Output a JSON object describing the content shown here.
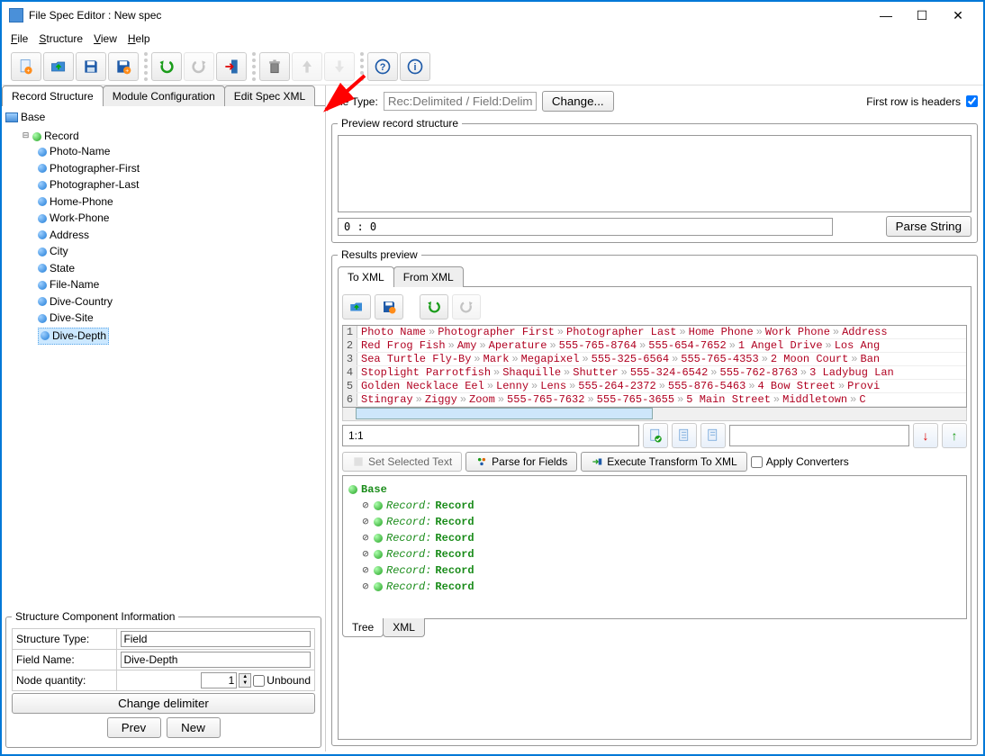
{
  "window": {
    "title": "File Spec Editor : New spec"
  },
  "menu": {
    "file": "File",
    "structure": "Structure",
    "view": "View",
    "help": "Help"
  },
  "main_tabs": {
    "record_structure": "Record Structure",
    "module_configuration": "Module Configuration",
    "edit_spec_xml": "Edit Spec XML"
  },
  "tree": {
    "root": "Base",
    "record": "Record",
    "fields": [
      "Photo-Name",
      "Photographer-First",
      "Photographer-Last",
      "Home-Phone",
      "Work-Phone",
      "Address",
      "City",
      "State",
      "File-Name",
      "Dive-Country",
      "Dive-Site",
      "Dive-Depth"
    ],
    "selected": "Dive-Depth"
  },
  "struct_info": {
    "legend": "Structure Component Information",
    "structure_type_label": "Structure Type:",
    "structure_type_value": "Field",
    "field_name_label": "Field Name:",
    "field_name_value": "Dive-Depth",
    "node_qty_label": "Node quantity:",
    "node_qty_value": "1",
    "unbound_label": "Unbound",
    "change_delimiter": "Change delimiter",
    "prev": "Prev",
    "new": "New"
  },
  "file_type": {
    "label": "File Type:",
    "placeholder": "Rec:Delimited / Field:Delimited",
    "change": "Change...",
    "first_row_headers": "First row is headers"
  },
  "preview": {
    "legend": "Preview record structure",
    "position": "0 : 0",
    "parse_string": "Parse String"
  },
  "results": {
    "legend": "Results preview",
    "to_xml": "To XML",
    "from_xml": "From XML",
    "pos": "1:1",
    "set_selected": "Set Selected Text",
    "parse_fields": "Parse for Fields",
    "execute_transform": "Execute Transform To XML",
    "apply_converters": "Apply Converters",
    "rows": [
      [
        "Photo Name",
        "Photographer First",
        "Photographer Last",
        "Home Phone",
        "Work Phone",
        "Address"
      ],
      [
        "Red Frog Fish",
        "Amy",
        "Aperature",
        "555-765-8764",
        "555-654-7652",
        "1 Angel Drive",
        "Los Ang"
      ],
      [
        "Sea Turtle Fly-By",
        "Mark",
        "Megapixel",
        "555-325-6564",
        "555-765-4353",
        "2 Moon Court",
        "Ban"
      ],
      [
        "Stoplight Parrotfish",
        "Shaquille",
        "Shutter",
        "555-324-6542",
        "555-762-8763",
        "3 Ladybug Lan"
      ],
      [
        "Golden Necklace Eel",
        "Lenny",
        "Lens",
        "555-264-2372",
        "555-876-5463",
        "4 Bow Street",
        "Provi"
      ],
      [
        "Stingray",
        "Ziggy",
        "Zoom",
        "555-765-7632",
        "555-765-3655",
        "5 Main Street",
        "Middletown",
        "C"
      ]
    ]
  },
  "result_tree": {
    "base": "Base",
    "record_label": "Record:",
    "record_value": "Record",
    "count": 6
  },
  "bottom_tabs": {
    "tree": "Tree",
    "xml": "XML"
  }
}
